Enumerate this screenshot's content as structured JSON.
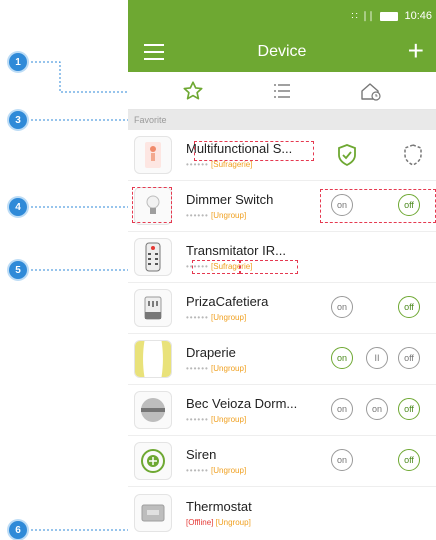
{
  "status": {
    "signal": "∷ ∣∣",
    "time": "10:46"
  },
  "appbar": {
    "title": "Device",
    "menu_icon": "menu-icon",
    "add_icon": "plus-icon"
  },
  "tabs": [
    {
      "icon": "star-icon",
      "selected": true
    },
    {
      "icon": "list-icon",
      "selected": false
    },
    {
      "icon": "home-clock-icon",
      "selected": false
    }
  ],
  "section": {
    "label": "Favorite"
  },
  "devices": [
    {
      "name": "Multifunctional S...",
      "dots": "••••••",
      "group": "[Sufragerie]",
      "controls": [
        "shield-check",
        "shield-dashed"
      ]
    },
    {
      "name": "Dimmer Switch",
      "dots": "••••••",
      "group": "[Ungroup]",
      "controls": [
        "on",
        "off"
      ]
    },
    {
      "name": "Transmitator IR...",
      "dots": "••••••",
      "group": "[Sufragerie]",
      "controls": []
    },
    {
      "name": "PrizaCafetiera",
      "dots": "••••••",
      "group": "[Ungroup]",
      "controls": [
        "on",
        "off"
      ]
    },
    {
      "name": "Draperie",
      "dots": "••••••",
      "group": "[Ungroup]",
      "controls": [
        "on",
        "pause",
        "off"
      ]
    },
    {
      "name": "Bec Veioza Dorm...",
      "dots": "••••••",
      "group": "[Ungroup]",
      "controls": [
        "on",
        "on",
        "off"
      ]
    },
    {
      "name": "Siren",
      "dots": "••••••",
      "group": "[Ungroup]",
      "controls": [
        "on",
        "off"
      ]
    },
    {
      "name": "Thermostat",
      "status": "[Offline]",
      "group": "[Ungroup]",
      "controls": []
    }
  ],
  "labels": {
    "on": "on",
    "off": "off",
    "pause": "II"
  },
  "callouts": [
    "1",
    "3",
    "4",
    "5",
    "6"
  ],
  "colors": {
    "accent": "#6ea832",
    "callout": "#2f8ad8",
    "highlight": "#e53950",
    "group": "#f0a020",
    "offline": "#e53935"
  }
}
